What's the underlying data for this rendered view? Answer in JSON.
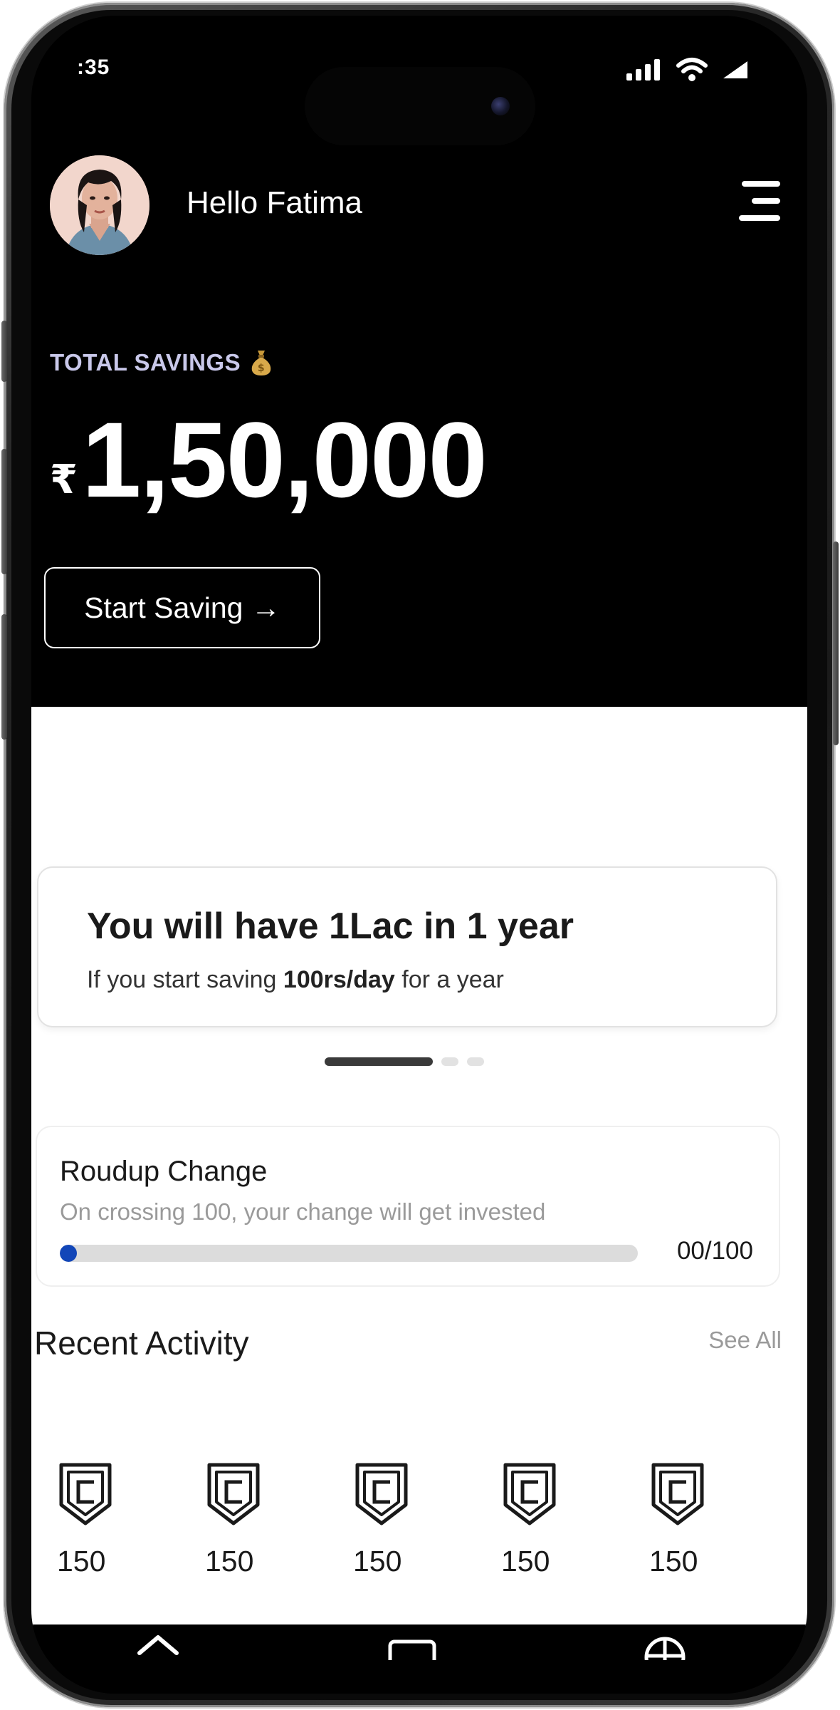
{
  "status_bar": {
    "time": ":35"
  },
  "header": {
    "greeting": "Hello Fatima"
  },
  "savings": {
    "label": "TOTAL SAVINGS",
    "currency": "₹",
    "amount": "1,50,000",
    "start_button": "Start Saving →"
  },
  "promo": {
    "title": "You will have 1Lac in 1 year",
    "sub_prefix": "If you start saving ",
    "sub_bold": "100rs/day",
    "sub_suffix": " for a year",
    "active_slide": 1,
    "slide_count": 3
  },
  "roundup": {
    "title": "Roudup Change",
    "subtitle": "On crossing 100, your change will get invested",
    "count_text": "00/100",
    "progress_fraction": 0.0
  },
  "recent": {
    "title": "Recent Activity",
    "see_all": "See All",
    "items": [
      {
        "amount": "150",
        "icon": "shield-badge-icon"
      },
      {
        "amount": "150",
        "icon": "shield-badge-icon"
      },
      {
        "amount": "150",
        "icon": "shield-badge-icon"
      },
      {
        "amount": "150",
        "icon": "shield-badge-icon"
      },
      {
        "amount": "150",
        "icon": "shield-badge-icon"
      }
    ]
  },
  "nav": {
    "items": [
      "home-icon",
      "card-icon",
      "globe-icon"
    ]
  },
  "colors": {
    "background_dark": "#000000",
    "savings_label": "#c9c8ea",
    "progress_fill": "#1246b8",
    "muted_text": "#9a9a9a"
  }
}
